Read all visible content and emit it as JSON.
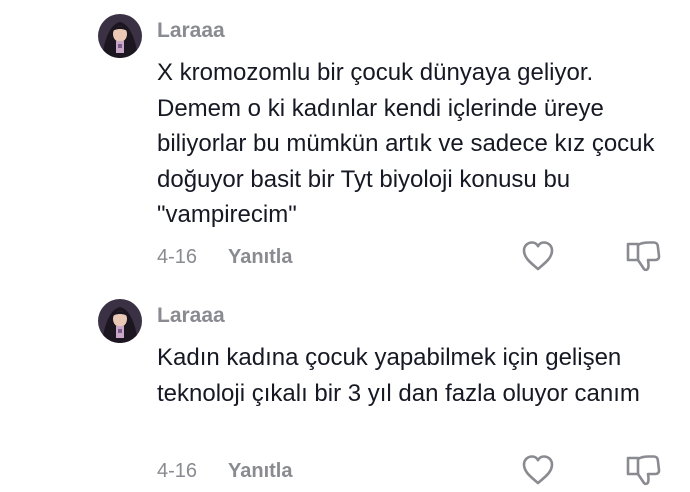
{
  "comments": [
    {
      "username": "Laraaa",
      "text": "X kromozomlu bir çocuk dünyaya geliyor. Demem o ki kadınlar kendi içlerinde üreye biliyorlar bu mümkün artık ve sadece kız çocuk doğuyor basit bir Tyt biyoloji konusu bu \"vampirecim\"",
      "date": "4-16",
      "reply_label": "Yanıtla",
      "like_icon": "heart-outline-icon",
      "dislike_icon": "thumbs-down-icon"
    },
    {
      "username": "Laraaa",
      "text": "Kadın kadına çocuk yapabilmek için gelişen teknoloji çıkalı bir 3 yıl dan fazla oluyor canım",
      "date": "4-16",
      "reply_label": "Yanıtla",
      "like_icon": "heart-outline-icon",
      "dislike_icon": "thumbs-down-icon"
    }
  ],
  "colors": {
    "text_primary": "#161823",
    "text_secondary": "#8a8b91",
    "icon_stroke": "#8a8b91"
  }
}
